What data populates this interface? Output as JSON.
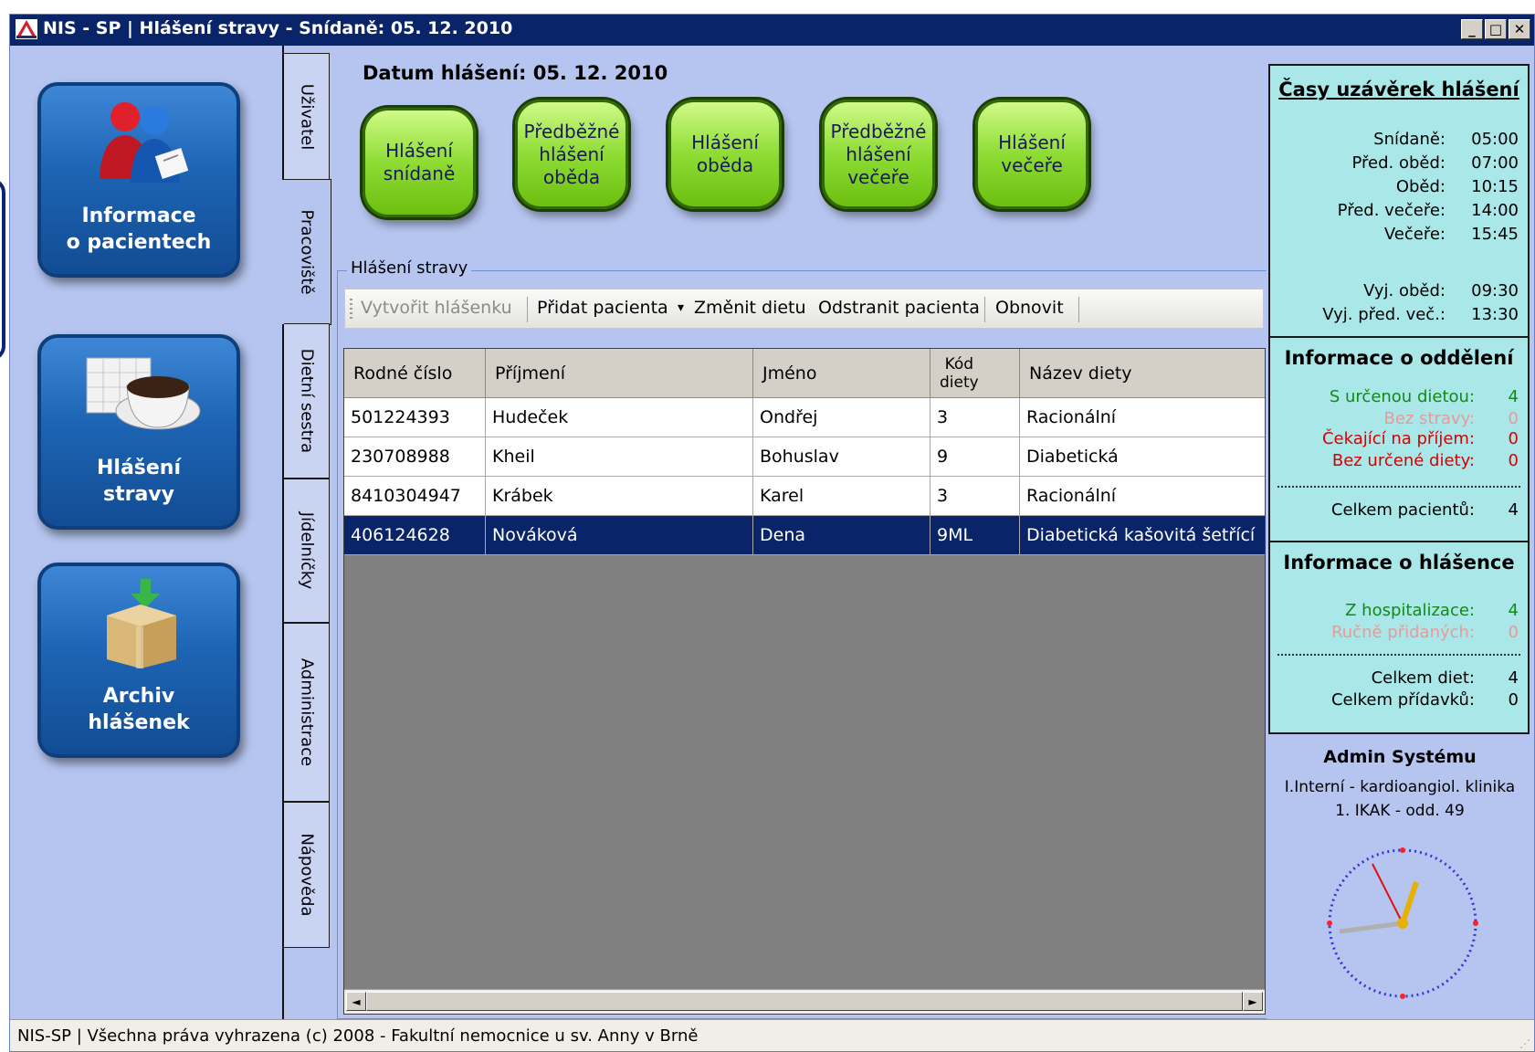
{
  "window": {
    "title": "NIS - SP | Hlášení stravy - Snídaně: 05. 12. 2010",
    "controls": [
      "_",
      "□",
      "✕"
    ]
  },
  "nav": [
    {
      "label1": "Informace",
      "label2": "o pacientech",
      "icon": "patients-icon"
    },
    {
      "label1": "Hlášení",
      "label2": "stravy",
      "icon": "coffee-cup-calendar-icon"
    },
    {
      "label1": "Archiv",
      "label2": "hlášenek",
      "icon": "archive-box-icon"
    }
  ],
  "tabs": [
    "Uživatel",
    "Pracoviště",
    "Dietní sestra",
    "Jídelníčky",
    "Administrace",
    "Nápověda"
  ],
  "datum": "Datum hlášení: 05. 12. 2010",
  "meal_buttons": [
    {
      "l1": "Hlášení",
      "l2": "snídaně",
      "l3": ""
    },
    {
      "l1": "Předběžné",
      "l2": "hlášení",
      "l3": "oběda"
    },
    {
      "l1": "Hlášení",
      "l2": "oběda",
      "l3": ""
    },
    {
      "l1": "Předběžné",
      "l2": "hlášení",
      "l3": "večeře"
    },
    {
      "l1": "Hlášení",
      "l2": "večeře",
      "l3": ""
    }
  ],
  "group": {
    "legend": "Hlášení stravy",
    "toolbar": {
      "create": "Vytvořit hlášenku",
      "add_patient": "Přidat pacienta",
      "dropdown_arrow": "▾",
      "change_diet": "Změnit dietu",
      "remove_patient": "Odstranit pacienta",
      "refresh": "Obnovit"
    }
  },
  "table": {
    "headers": {
      "rc": "Rodné číslo",
      "surname": "Příjmení",
      "name": "Jméno",
      "code1": "Kód",
      "code2": "diety",
      "diet": "Název diety"
    },
    "rows": [
      [
        "501224393",
        "Hudeček",
        "Ondřej",
        "3",
        "Racionální"
      ],
      [
        "230708988",
        "Kheil",
        "Bohuslav",
        "9",
        "Diabetická"
      ],
      [
        "8410304947",
        "Krábek",
        "Karel",
        "3",
        "Racionální"
      ],
      [
        "406124628",
        "Nováková",
        "Dena",
        "9ML",
        "Diabetická kašovitá šetřící"
      ]
    ],
    "selected_row": 3,
    "scroll_left": "◄",
    "scroll_right": "►"
  },
  "deadlines": {
    "title": "Časy uzávěrek hlášení",
    "items": [
      {
        "k": "Snídaně:",
        "v": "05:00"
      },
      {
        "k": "Před. oběd:",
        "v": "07:00"
      },
      {
        "k": "Oběd:",
        "v": "10:15"
      },
      {
        "k": "Před. večeře:",
        "v": "14:00"
      },
      {
        "k": "Večeře:",
        "v": "15:45"
      },
      {
        "k": "Vyj. oběd:",
        "v": "09:30"
      },
      {
        "k": "Vyj. před. več.:",
        "v": "13:30"
      }
    ]
  },
  "department": {
    "title": "Informace o oddělení",
    "items": [
      {
        "k": "S určenou dietou:",
        "v": "4"
      },
      {
        "k": "Bez stravy:",
        "v": "0"
      },
      {
        "k": "Čekající na příjem:",
        "v": "0"
      },
      {
        "k": "Bez určené diety:",
        "v": "0"
      }
    ],
    "total": {
      "k": "Celkem pacientů:",
      "v": "4"
    }
  },
  "report": {
    "title": "Informace o hlášence",
    "items": [
      {
        "k": "Z hospitalizace:",
        "v": "4"
      },
      {
        "k": "Ručně přidaných:",
        "v": "0"
      }
    ],
    "totals": [
      {
        "k": "Celkem diet:",
        "v": "4"
      },
      {
        "k": "Celkem přídavků:",
        "v": "0"
      }
    ]
  },
  "user": {
    "name": "Admin Systému",
    "dept1": "I.Interní - kardioangiol. klinika",
    "dept2": "1. IKAK - odd. 49"
  },
  "colors": {
    "window_bg": "#b5c5ef",
    "title_bar": "#0a246a",
    "info_panel": "#a9e7e8",
    "selection": "#0a246a",
    "green": "#138a13",
    "pink": "#e79a9a",
    "red": "#d70000"
  },
  "status": "NIS-SP | Všechna práva vyhrazena (c) 2008 - Fakultní nemocnice u sv. Anny v Brně"
}
